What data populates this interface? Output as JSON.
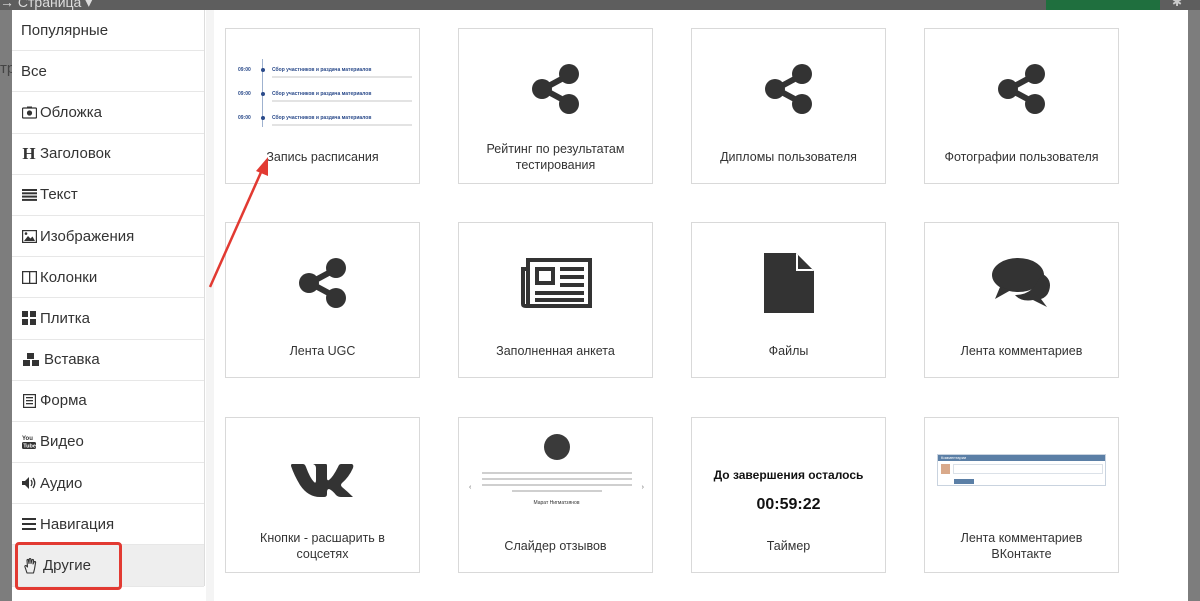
{
  "background": {
    "page_label": "→ Страница ▾",
    "left_fragment": "тр",
    "gear_icon": "gear-icon"
  },
  "sidebar": {
    "items": [
      {
        "label": "Популярные",
        "icon": ""
      },
      {
        "label": "Все",
        "icon": ""
      },
      {
        "label": "Обложка",
        "icon": "camera-icon"
      },
      {
        "label": "Заголовок",
        "icon": "heading-icon"
      },
      {
        "label": "Текст",
        "icon": "align-justify-icon"
      },
      {
        "label": "Изображения",
        "icon": "image-icon"
      },
      {
        "label": "Колонки",
        "icon": "columns-icon"
      },
      {
        "label": "Плитка",
        "icon": "grid-icon"
      },
      {
        "label": "Вставка",
        "icon": "cubes-icon"
      },
      {
        "label": "Форма",
        "icon": "form-icon"
      },
      {
        "label": "Видео",
        "icon": "youtube-icon"
      },
      {
        "label": "Аудио",
        "icon": "volume-icon"
      },
      {
        "label": "Навигация",
        "icon": "bars-icon"
      },
      {
        "label": "Другие",
        "icon": "hand-icon",
        "active": true
      }
    ]
  },
  "cards": [
    {
      "label": "Запись расписания",
      "thumb": "schedule"
    },
    {
      "label": "Рейтинг по результатам тестирования",
      "thumb": "share-icon"
    },
    {
      "label": "Дипломы пользователя",
      "thumb": "share-icon"
    },
    {
      "label": "Фотографии пользователя",
      "thumb": "share-icon"
    },
    {
      "label": "Лента UGC",
      "thumb": "share-icon"
    },
    {
      "label": "Заполненная анкета",
      "thumb": "newspaper-icon"
    },
    {
      "label": "Файлы",
      "thumb": "file-icon"
    },
    {
      "label": "Лента комментариев",
      "thumb": "comments-icon"
    },
    {
      "label": "Кнопки - расшарить в соцсетях",
      "thumb": "vk-icon"
    },
    {
      "label": "Слайдер отзывов",
      "thumb": "slider"
    },
    {
      "label": "Таймер",
      "thumb": "timer"
    },
    {
      "label": "Лента комментариев ВКонтакте",
      "thumb": "vk-comments"
    }
  ],
  "schedule_preview": {
    "rows": [
      {
        "time": "09:00",
        "title": "Сбор участников и раздача материалов"
      },
      {
        "time": "09:00",
        "title": "Сбор участников и раздача материалов"
      },
      {
        "time": "09:00",
        "title": "Сбор участников и раздача материалов"
      }
    ]
  },
  "slider_preview": {
    "name": "Марат Нигматзянов"
  },
  "timer_preview": {
    "title": "До завершения осталось",
    "value": "00:59:22"
  },
  "vk_preview": {
    "header": "Комментарии",
    "button": "Отправить"
  },
  "annotation": {
    "highlight_color": "#e23a32",
    "arrow_color": "#e23a32"
  }
}
